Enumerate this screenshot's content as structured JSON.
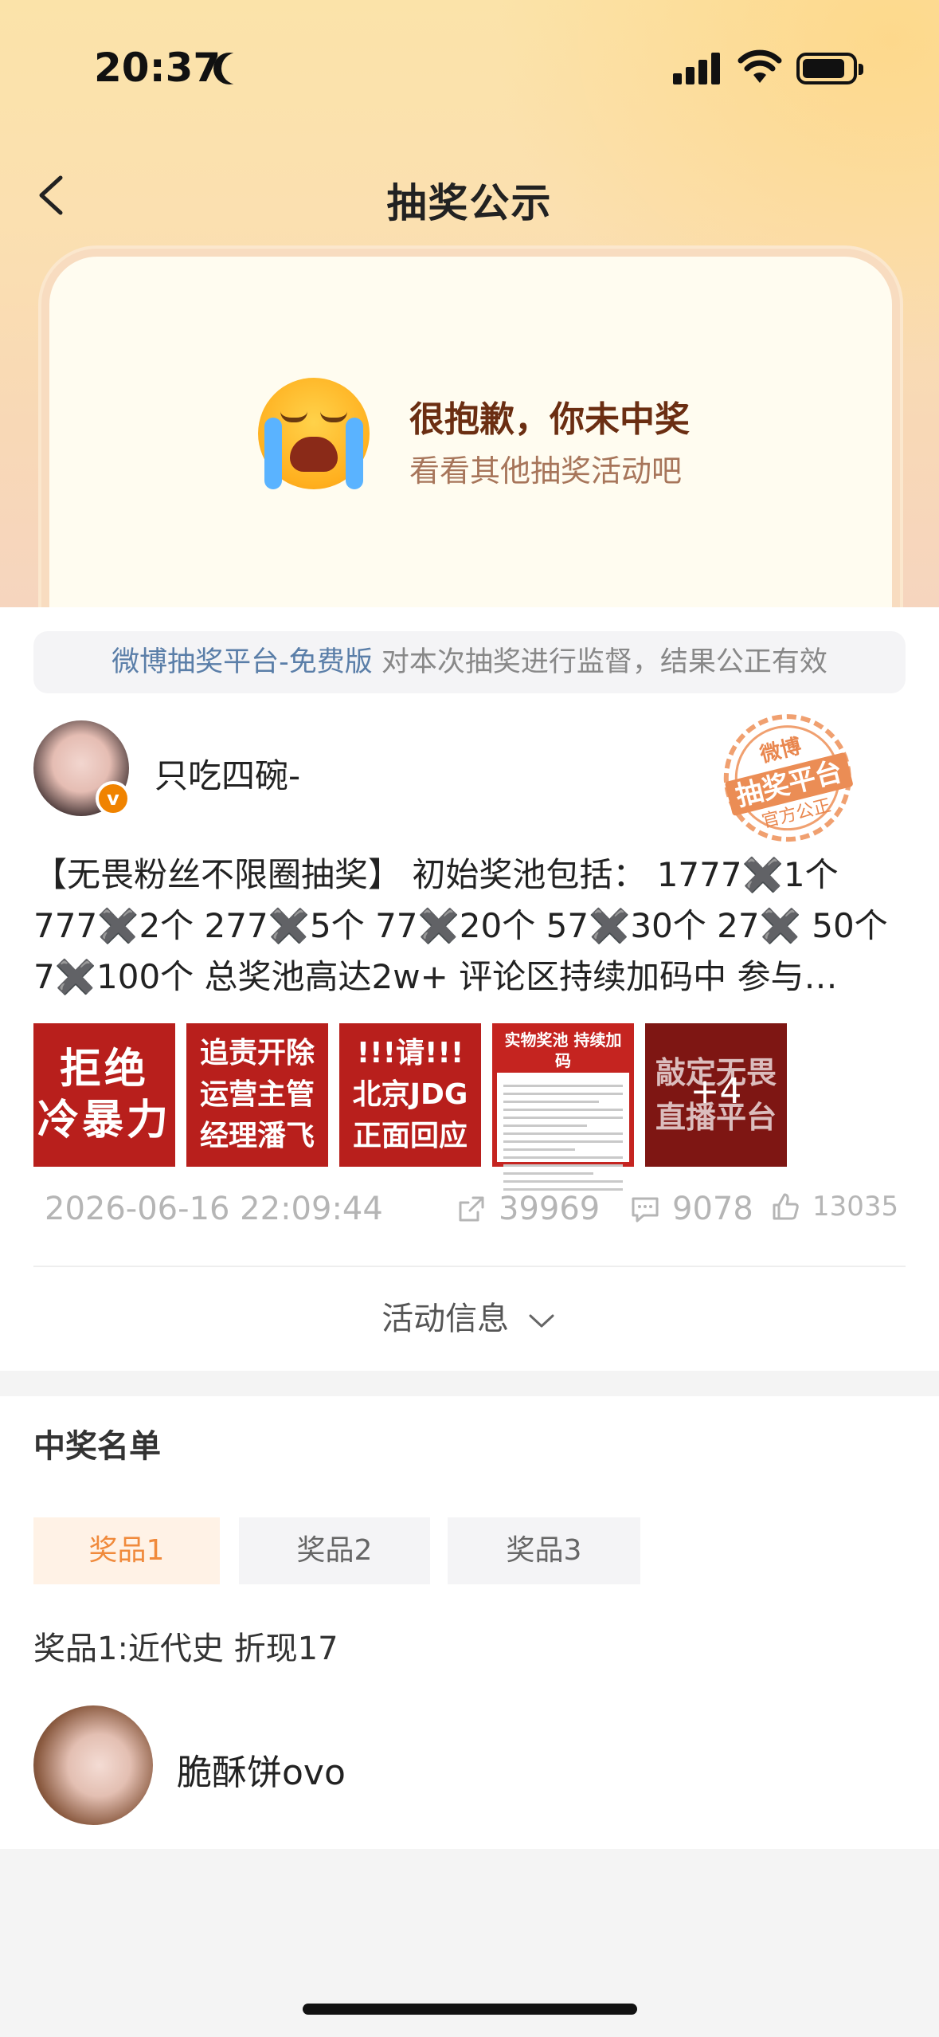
{
  "status_bar": {
    "time": "20:37"
  },
  "nav": {
    "title": "抽奖公示"
  },
  "result": {
    "title": "很抱歉，你未中奖",
    "subtitle": "看看其他抽奖活动吧"
  },
  "supervision": {
    "link_text": "微博抽奖平台-免费版",
    "text": " 对本次抽奖进行监督，结果公正有效"
  },
  "post": {
    "author": "只吃四碗-",
    "stamp": {
      "top": "微博",
      "middle": "抽奖平台",
      "bottom": "官方公正"
    },
    "text": "【无畏粉丝不限圈抽奖】 初始奖池包括： 1777✖️1个 777✖️2个 277✖️5个 77✖️20个 57✖️30个 27✖️ 50个 7✖️100个 总奖池高达2w+ 评论区持续加码中 参与…",
    "thumbnails": [
      {
        "lines": [
          "拒绝",
          "冷暴力"
        ]
      },
      {
        "lines": [
          "追责开除",
          "运营主管",
          "经理潘飞"
        ]
      },
      {
        "lines": [
          "!!!请!!!",
          "北京JDG",
          "正面回应"
        ]
      },
      {
        "header": "实物奖池 持续加码"
      },
      {
        "lines": [
          "敲定无畏",
          "直播平台"
        ],
        "more": "+4"
      }
    ],
    "date": "2026-06-16 22:09:44",
    "shares": "39969",
    "comments": "9078",
    "likes": "13035"
  },
  "activity_info": {
    "label": "活动信息"
  },
  "winners": {
    "title": "中奖名单",
    "tabs": [
      "奖品1",
      "奖品2",
      "奖品3"
    ],
    "active_tab": "奖品1",
    "prize_desc": "奖品1:近代史 折现17",
    "winner_name": "脆酥饼ovo"
  },
  "colors": {
    "accent": "#f08a3c",
    "link": "#5a7ea8",
    "thumb_red": "#b81f1c"
  }
}
